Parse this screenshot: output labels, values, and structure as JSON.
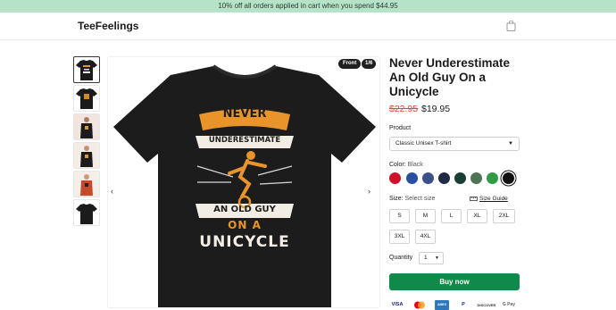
{
  "promo": {
    "text": "10% off all orders applied in cart when you spend $44.95"
  },
  "header": {
    "brand": "TeeFeelings",
    "cart_icon": "shopping-bag-icon"
  },
  "gallery": {
    "badge_view": "Front",
    "badge_count": "1/6",
    "prev_icon": "chevron-left-icon",
    "next_icon": "chevron-right-icon",
    "shirt_text": {
      "line1": "NEVER",
      "line2": "UNDERESTIMATE",
      "line3": "AN OLD GUY",
      "line4": "ON A",
      "line5": "UNICYCLE"
    }
  },
  "product": {
    "title": "Never Underestimate An Old Guy On a Unicycle",
    "price_old": "$22.95",
    "price_new": "$19.95",
    "product_label": "Product",
    "product_value": "Classic Unisex T-shirt",
    "color_label": "Color:",
    "color_value": "Black",
    "colors": [
      "#d0112b",
      "#2a4ea3",
      "#3c4f86",
      "#1f2a44",
      "#1a3d36",
      "#4e7355",
      "#2e9b46",
      "#111111"
    ],
    "size_label": "Size:",
    "size_value": "Select size",
    "size_guide": "Size Guide",
    "sizes_row1": [
      "S",
      "M",
      "L",
      "XL",
      "2XL"
    ],
    "sizes_row2": [
      "3XL",
      "4XL"
    ],
    "quantity_label": "Quantity",
    "quantity_value": "1",
    "buy_label": "Buy now",
    "payments": [
      "VISA",
      "",
      "AMEX",
      "P",
      "DISCOVER",
      "G Pay"
    ]
  },
  "colors": {
    "accent": "#0f8a4a",
    "promo_bg": "#b6e3c7",
    "sale": "#e0473e",
    "shirt": "#1b1b1b",
    "shirt_print": "#e8942a"
  }
}
